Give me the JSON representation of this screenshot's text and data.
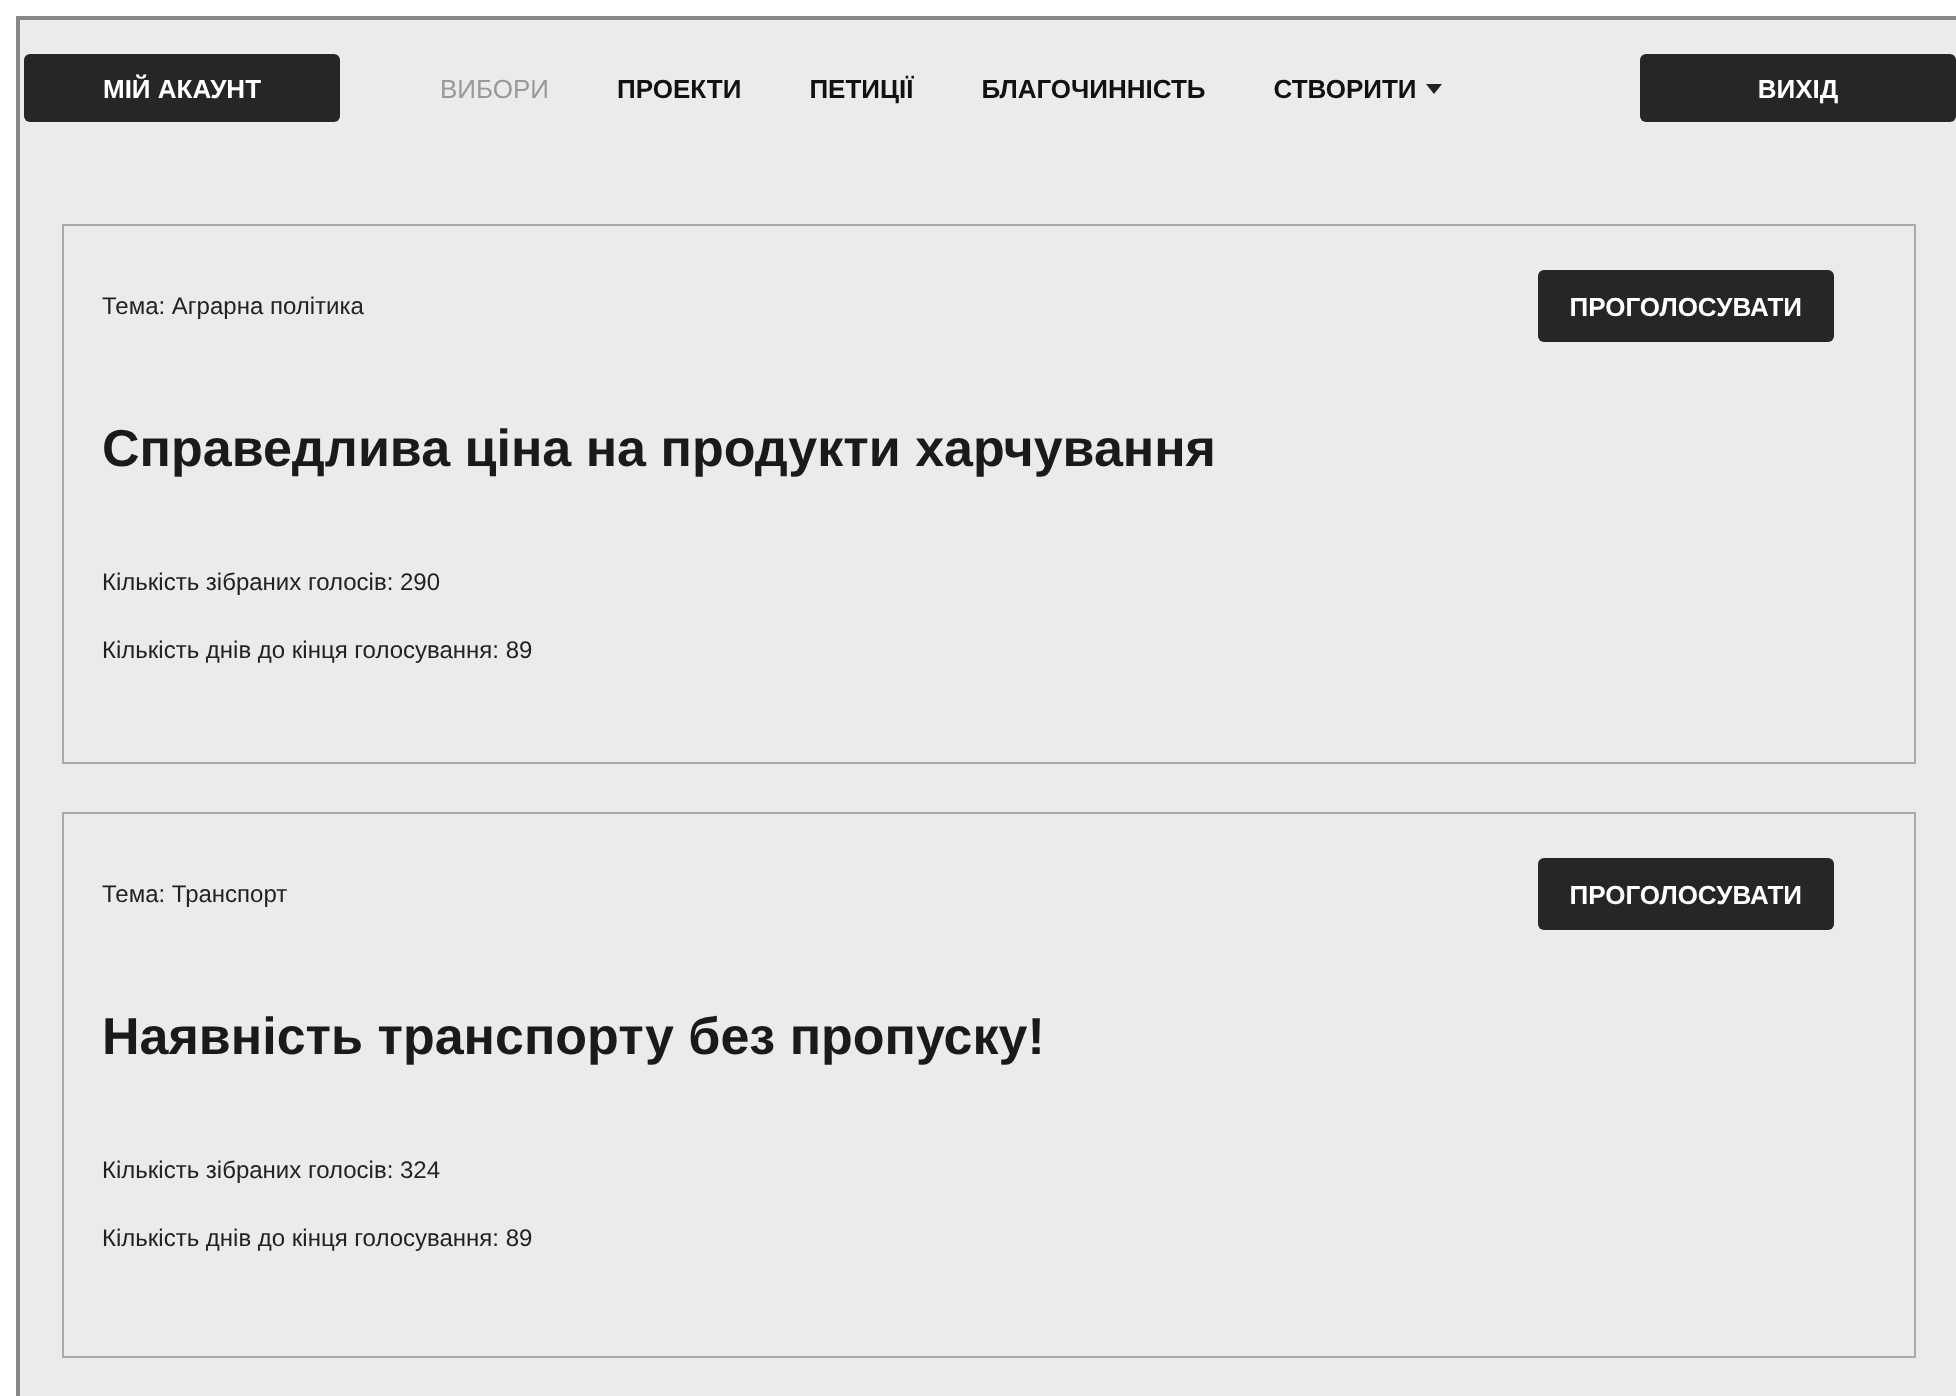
{
  "account_button": "МІЙ АКАУНТ",
  "nav": [
    {
      "label": "ВИБОРИ",
      "selected": true,
      "kind": "link"
    },
    {
      "label": "ПРОЕКТИ",
      "selected": false,
      "kind": "link"
    },
    {
      "label": "ПЕТИЦІЇ",
      "selected": false,
      "kind": "link"
    },
    {
      "label": "БЛАГОЧИННІСТЬ",
      "selected": false,
      "kind": "link"
    },
    {
      "label": "СТВОРИТИ",
      "selected": false,
      "kind": "dropdown"
    }
  ],
  "logout_button": "ВИХІД",
  "cards": [
    {
      "topic": "Тема: Аграрна політика",
      "vote_button": "ПРОГОЛОСУВАТИ",
      "title": "Справедлива ціна на продукти харчування",
      "votes": "Кількість зібраних голосів: 290",
      "days_left": "Кількість днів до кінця голосування: 89"
    },
    {
      "topic": "Тема: Транспорт",
      "vote_button": "ПРОГОЛОСУВАТИ",
      "title": "Наявність транспорту без пропуску!",
      "votes": "Кількість зібраних голосів: 324",
      "days_left": "Кількість днів до кінця голосування: 89"
    }
  ]
}
